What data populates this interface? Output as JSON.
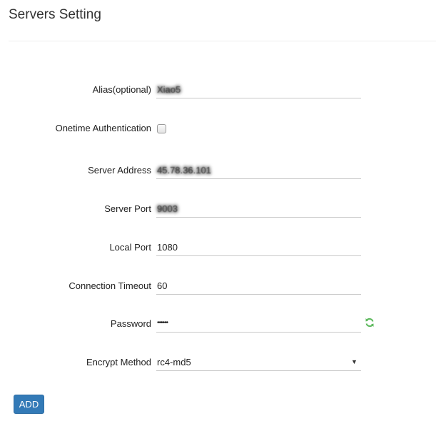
{
  "page": {
    "title": "Servers Setting"
  },
  "form": {
    "alias": {
      "label": "Alias(optional)",
      "value": "Xiao5"
    },
    "onetime_auth": {
      "label": "Onetime Authentication",
      "checked": false
    },
    "server_address": {
      "label": "Server Address",
      "value": "45.78.36.101"
    },
    "server_port": {
      "label": "Server Port",
      "value": "9003"
    },
    "local_port": {
      "label": "Local Port",
      "value": "1080"
    },
    "timeout": {
      "label": "Connection Timeout",
      "value": "60"
    },
    "password": {
      "label": "Password",
      "value": "••••••",
      "icon": "refresh-icon",
      "icon_color": "#5cb85c"
    },
    "encrypt_method": {
      "label": "Encrypt Method",
      "value": "rc4-md5",
      "arrow": "▼"
    }
  },
  "actions": {
    "add_label": "ADD",
    "add_color": "#337ab7"
  }
}
